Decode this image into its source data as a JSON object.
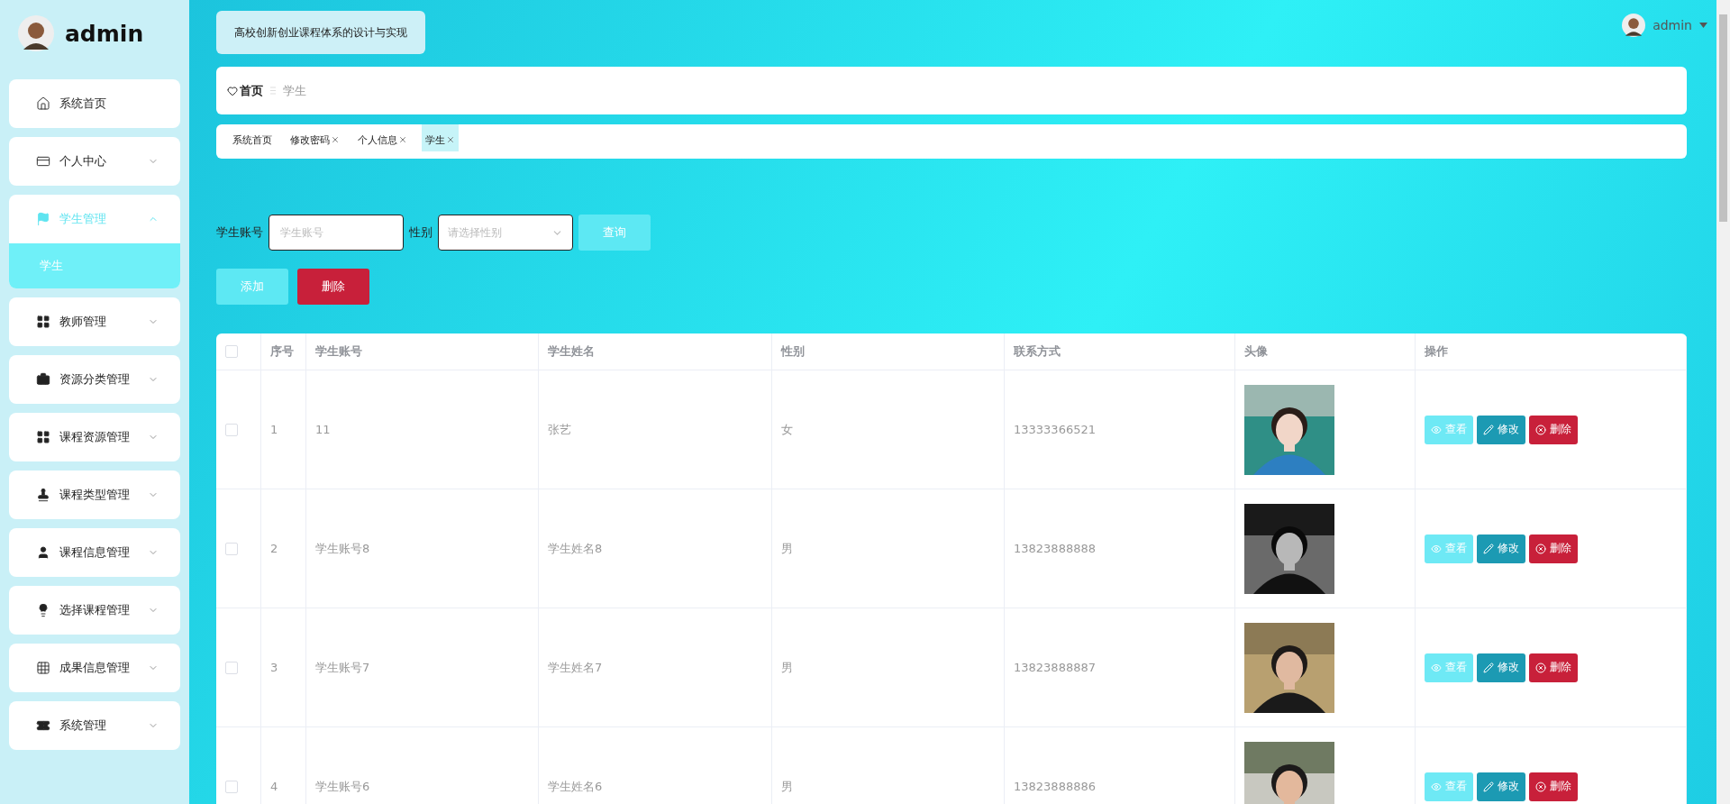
{
  "sidebar": {
    "user": {
      "name": "admin"
    },
    "menu": [
      {
        "label": "系统首页",
        "kind": "link"
      },
      {
        "label": "个人中心",
        "kind": "group",
        "expanded": false
      },
      {
        "label": "学生管理",
        "kind": "group",
        "expanded": true,
        "children": [
          {
            "label": "学生",
            "selected": true
          }
        ]
      },
      {
        "label": "教师管理",
        "kind": "group",
        "expanded": false
      },
      {
        "label": "资源分类管理",
        "kind": "group",
        "expanded": false
      },
      {
        "label": "课程资源管理",
        "kind": "group",
        "expanded": false
      },
      {
        "label": "课程类型管理",
        "kind": "group",
        "expanded": false
      },
      {
        "label": "课程信息管理",
        "kind": "group",
        "expanded": false
      },
      {
        "label": "选择课程管理",
        "kind": "group",
        "expanded": false
      },
      {
        "label": "成果信息管理",
        "kind": "group",
        "expanded": false
      },
      {
        "label": "系统管理",
        "kind": "group",
        "expanded": false
      }
    ]
  },
  "header": {
    "title": "高校创新创业课程体系的设计与实现",
    "user": {
      "name": "admin"
    }
  },
  "breadcrumb": {
    "home": "首页",
    "current": "学生"
  },
  "tags": [
    {
      "label": "系统首页",
      "closable": false,
      "selected": false
    },
    {
      "label": "修改密码",
      "closable": true,
      "selected": false
    },
    {
      "label": "个人信息",
      "closable": true,
      "selected": false
    },
    {
      "label": "学生",
      "closable": true,
      "selected": true
    }
  ],
  "search": {
    "fields": [
      {
        "label": "学生账号",
        "kind": "input",
        "placeholder": "学生账号"
      },
      {
        "label": "性别",
        "kind": "select",
        "placeholder": "请选择性别"
      }
    ],
    "button": "查询"
  },
  "actions": [
    {
      "label": "添加",
      "kind": "add"
    },
    {
      "label": "删除",
      "kind": "delete"
    }
  ],
  "table": {
    "all_checked": false,
    "columns": [
      "序号",
      "学生账号",
      "学生姓名",
      "性别",
      "联系方式",
      "头像",
      "操作"
    ],
    "rows": [
      {
        "checked": false,
        "index": "1",
        "account": "11",
        "name": "张艺",
        "gender": "女",
        "phone": "13333366521",
        "avatar": {
          "kind": "picture"
        },
        "actions": [
          {
            "label": "查看",
            "kind": "view"
          },
          {
            "label": "修改",
            "kind": "edit"
          },
          {
            "label": "删除",
            "kind": "delete"
          }
        ]
      },
      {
        "checked": false,
        "index": "2",
        "account": "学生账号8",
        "name": "学生姓名8",
        "gender": "男",
        "phone": "13823888888",
        "avatar": {
          "kind": "picture"
        },
        "actions": [
          {
            "label": "查看",
            "kind": "view"
          },
          {
            "label": "修改",
            "kind": "edit"
          },
          {
            "label": "删除",
            "kind": "delete"
          }
        ]
      },
      {
        "checked": false,
        "index": "3",
        "account": "学生账号7",
        "name": "学生姓名7",
        "gender": "男",
        "phone": "13823888887",
        "avatar": {
          "kind": "picture"
        },
        "actions": [
          {
            "label": "查看",
            "kind": "view"
          },
          {
            "label": "修改",
            "kind": "edit"
          },
          {
            "label": "删除",
            "kind": "delete"
          }
        ]
      },
      {
        "checked": false,
        "index": "4",
        "account": "学生账号6",
        "name": "学生姓名6",
        "gender": "男",
        "phone": "13823888886",
        "avatar": {
          "kind": "picture"
        },
        "actions": [
          {
            "label": "查看",
            "kind": "view"
          },
          {
            "label": "修改",
            "kind": "edit"
          },
          {
            "label": "删除",
            "kind": "delete"
          }
        ]
      }
    ]
  }
}
